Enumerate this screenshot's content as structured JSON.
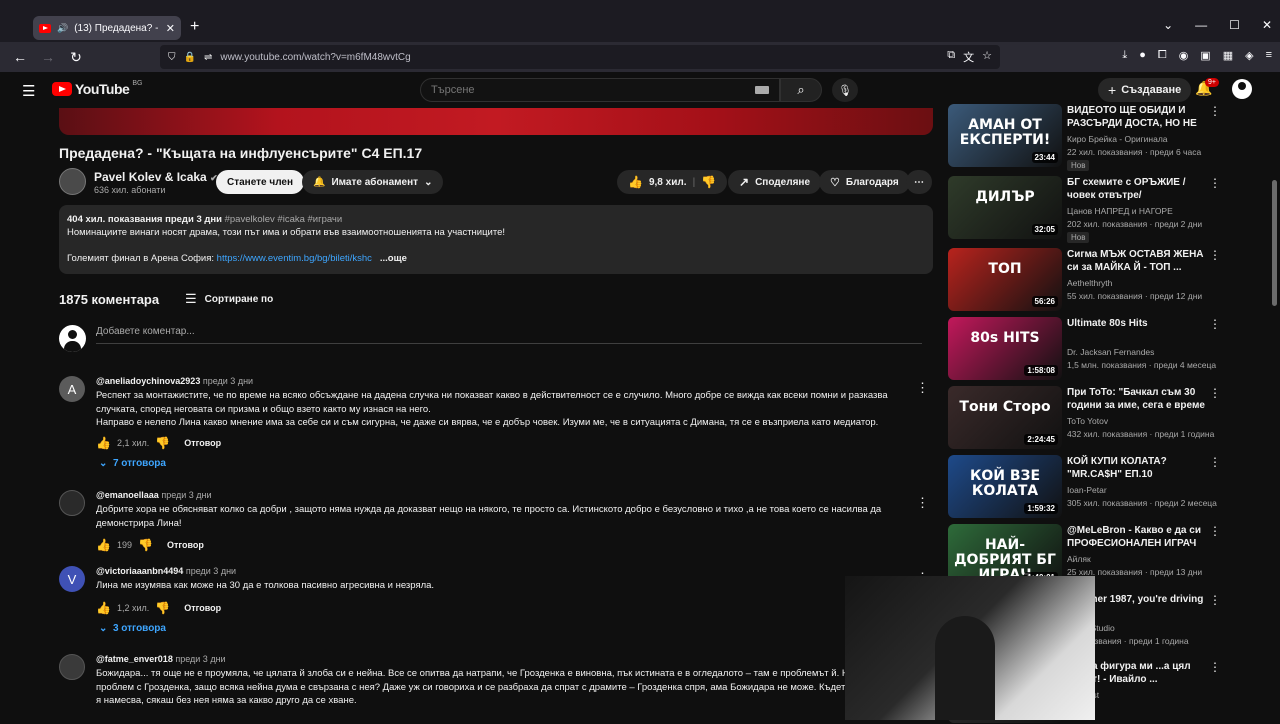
{
  "browser": {
    "tab_title": "(13) Предадена? - \"Къщата",
    "url": "www.youtube.com/watch?v=m6fM48wvtCg"
  },
  "header": {
    "logo_text": "YouTube",
    "country_code": "BG",
    "search_placeholder": "Търсене",
    "create_label": "Създаване",
    "notif_count": "9+"
  },
  "video": {
    "title": "Предадена? - \"Къщата на инфлуенсърите\" С4 ЕП.17",
    "channel": "Pavel Kolev & Icaka",
    "subscribers": "636 хил. абонати",
    "join_label": "Станете член",
    "subscribed_label": "Имате абонамент",
    "likes": "9,8 хил.",
    "share_label": "Споделяне",
    "thanks_label": "Благодаря",
    "description": {
      "views_date": "404 хил. показвания  преди 3 дни",
      "tags": "#pavelkolev #icaka #играчи",
      "line1": "Номинациите винаги носят драма, този път има и обрати във взаимоотношенията на участниците!",
      "line2_prefix": "Големият финал в Арена София: ",
      "link": "https://www.eventim.bg/bg/bileti/kshc",
      "more": "...още"
    }
  },
  "comments": {
    "count_label": "1875 коментара",
    "sort_label": "Сортиране по",
    "add_placeholder": "Добавете коментар...",
    "reply_label": "Отговор",
    "items": [
      {
        "avatar_letter": "A",
        "author": "@aneliadoychinova2923",
        "time": "преди 3 дни",
        "text": "Респект за монтажистите, че по време на всяко обсъждане на дадена случка ни показват какво в действителност се е случило. Много добре се вижда как всеки помни и разказва случката, според неговата си призма и общо взето както му изнася на него.",
        "text2": "Направо е нелепо Лина какво мнение има за себе си и съм сигурна, че даже си вярва, че е добър човек. Изуми ме, че в ситуацията с Димана, тя се е възприела като медиатор.",
        "likes": "2,1 хил.",
        "replies": "7 отговора"
      },
      {
        "avatar_letter": "",
        "author": "@emanoellaaa",
        "time": "преди 3 дни",
        "text": "Добрите хора не обясняват колко са добри , защото няма нужда да доказват нещо на някого, те просто са. Истинското добро е безусловно и тихо ,а не това което се насилва да демонстрира Лина!",
        "likes": "199"
      },
      {
        "avatar_letter": "V",
        "author": "@victoriaaanbn4494",
        "time": "преди 3 дни",
        "text": "Лина ме изумява как може на 30 да е толкова пасивно агресивна и незряла.",
        "likes": "1,2 хил.",
        "replies": "3 отговора"
      },
      {
        "avatar_letter": "",
        "author": "@fatme_enver018",
        "time": "преди 3 дни",
        "text": "Божидара... тя още не е проумяла, че цялата й злоба си е нейна. Все се опитва да натрапи, че Грозденка е виновна, пък истината е в огледалото – там е проблемът й. Н",
        "text2": "проблем с Грозденка, защо всяка нейна дума е свързана с нея? Даже уж си говорихa и се разбраха да спрат с драмите – Грозденка спря, ама Божидара не може. Къдет",
        "text3": "я намесва, сякаш без нея няма за какво друго да се хване."
      }
    ]
  },
  "recommendations": [
    {
      "title": "ВИДЕОТО ЩЕ ОБИДИ И РАЗСЪРДИ ДОСТА, НО НЕ М...",
      "channel": "Киро Брейка - Оригинала",
      "stats": "22 хил. показвания · преди 6 часа",
      "badge": "Нов",
      "duration": "23:44",
      "thumb_text": "АМАН ОТ ЕКСПЕРТИ!",
      "color": "#3b5a7a"
    },
    {
      "title": "БГ схемите с ОРЪЖИЕ /човек отвътре/",
      "channel": "Цанов НАПРЕД и НАГОРЕ",
      "stats": "202 хил. показвания · преди 2 дни",
      "badge": "Нов",
      "duration": "32:05",
      "thumb_text": "ДИЛЪР",
      "color": "#2f3b2a"
    },
    {
      "title": "Сигма МЪЖ ОСТАВЯ ЖЕНА си за МАЙКА Й - ТОП ...",
      "channel": "Aethelthryth",
      "stats": "55 хил. показвания · преди 12 дни",
      "duration": "56:26",
      "thumb_text": "ТОП",
      "color": "#b8231d"
    },
    {
      "title": "Ultimate 80s Hits",
      "channel": "Dr. Jacksan Fernandes",
      "stats": "1,5 млн. показвания · преди 4 месеца",
      "duration": "1:58:08",
      "thumb_text": "80s HITS",
      "color": "#c2185b"
    },
    {
      "title": "При ТоТо: \"Бачкал съм 30 години за име, сега е време ...",
      "channel": "ToTo Yotov",
      "stats": "432 хил. показвания · преди 1 година",
      "duration": "2:24:45",
      "thumb_text": "Тони Сторо",
      "color": "#3a2a2a"
    },
    {
      "title": "КОЙ КУПИ КОЛАТА? \"MR.CA$H\" ЕП.10",
      "channel": "Ioan-Petar",
      "stats": "305 хил. показвания · преди 2 месеца",
      "duration": "1:59:32",
      "thumb_text": "КОЙ ВЗЕ КОЛАТА",
      "color": "#1e4a8a"
    },
    {
      "title": "@MeLeBron - Какво е да си ПРОФЕСИОНАЛЕН ИГРАЧ на...",
      "channel": "Айляк",
      "stats": "25 хил. показвания · преди 13 дни",
      "duration": "1:40:01",
      "thumb_text": "НАЙ-ДОБРИЯТ БГ ИГРАЧ",
      "color": "#2e6b3a"
    },
    {
      "title": "Summer 1987, you're driving ... mi",
      "channel": "...app Studio",
      "stats": "... показвания · преди 1 година",
      "color": "#333333"
    },
    {
      "title": "...нска фигура ми ...а цял живот! - Ивайло ...",
      "channel": "...odcast",
      "stats": "",
      "color": "#333333"
    }
  ]
}
